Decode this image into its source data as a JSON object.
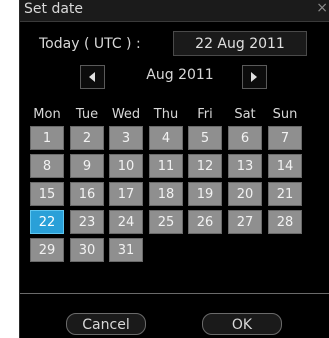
{
  "window": {
    "title": "Set date",
    "close_symbol": "×"
  },
  "today": {
    "label": "Today ( UTC ) :",
    "value": "22 Aug 2011"
  },
  "navigator": {
    "month_label": "Aug  2011",
    "prev_icon": "triangle-left",
    "next_icon": "triangle-right"
  },
  "weekdays": [
    "Mon",
    "Tue",
    "Wed",
    "Thu",
    "Fri",
    "Sat",
    "Sun"
  ],
  "days": [
    "1",
    "2",
    "3",
    "4",
    "5",
    "6",
    "7",
    "8",
    "9",
    "10",
    "11",
    "12",
    "13",
    "14",
    "15",
    "16",
    "17",
    "18",
    "19",
    "20",
    "21",
    "22",
    "23",
    "24",
    "25",
    "26",
    "27",
    "28",
    "29",
    "30",
    "31"
  ],
  "selected_day": "22",
  "buttons": {
    "cancel": "Cancel",
    "ok": "OK"
  },
  "colors": {
    "day_bg": "#8f8f8f",
    "selected_bg": "#2aa0d8",
    "background": "#000000"
  }
}
